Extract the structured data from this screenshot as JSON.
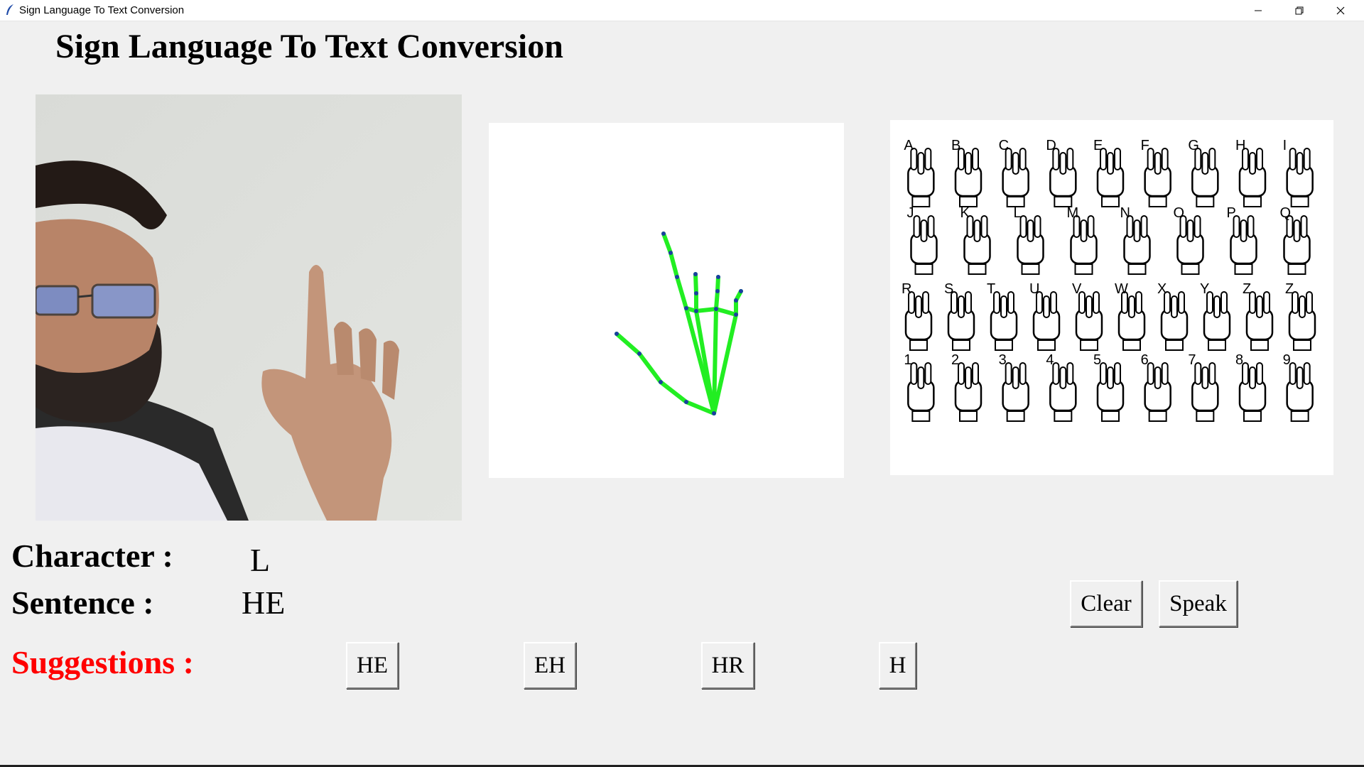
{
  "window": {
    "title": "Sign Language To Text Conversion",
    "controls": [
      "minimize-icon",
      "restore-icon",
      "close-icon"
    ]
  },
  "app": {
    "heading": "Sign Language To Text Conversion"
  },
  "panels": {
    "camera": "webcam-feed",
    "skeleton": "hand-landmark-skeleton",
    "reference": "asl-alphabet-chart"
  },
  "chart_labels": {
    "row1": [
      "A",
      "B",
      "C",
      "D",
      "E",
      "F",
      "G",
      "H",
      "I"
    ],
    "row2": [
      "J",
      "K",
      "L",
      "M",
      "N",
      "O",
      "P",
      "Q"
    ],
    "row3": [
      "R",
      "S",
      "T",
      "U",
      "V",
      "W",
      "X",
      "Y",
      "Z",
      "Z"
    ],
    "row4": [
      "1",
      "2",
      "3",
      "4",
      "5",
      "6",
      "7",
      "8",
      "9"
    ]
  },
  "output": {
    "character_label": "Character :",
    "character_value": "L",
    "sentence_label": "Sentence :",
    "sentence_value": "HE",
    "suggestions_label": "Suggestions :"
  },
  "suggestions": [
    "HE",
    "EH",
    "HR",
    "H"
  ],
  "actions": {
    "clear": "Clear",
    "speak": "Speak"
  },
  "colors": {
    "suggestions_label": "#ff0000",
    "skeleton_line": "#22ee22",
    "skeleton_point": "#1a3fa0",
    "background": "#f0f0f0"
  }
}
